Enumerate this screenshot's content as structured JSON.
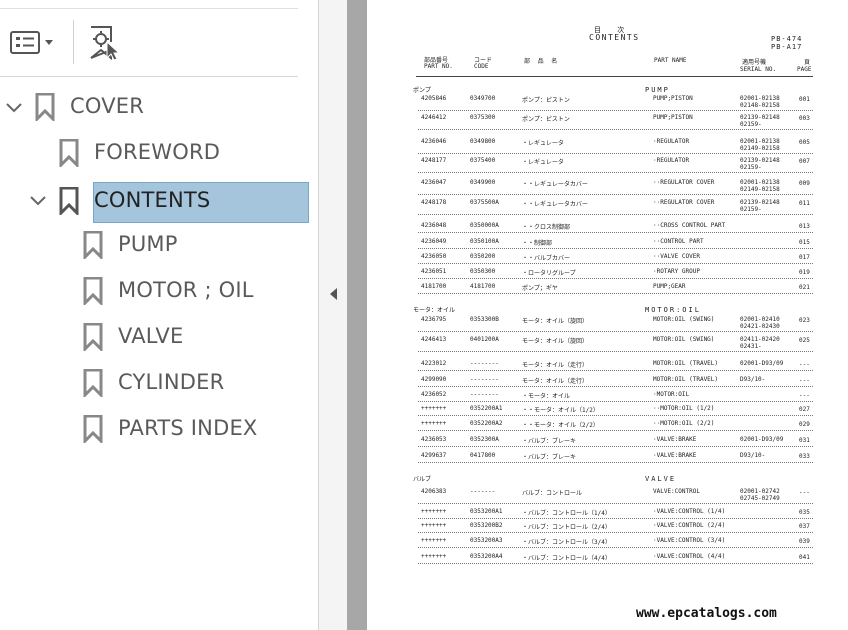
{
  "bookmarks": {
    "items": [
      {
        "label": "COVER",
        "level": 0,
        "expanded": true
      },
      {
        "label": "FOREWORD",
        "level": 1
      },
      {
        "label": "CONTENTS",
        "level": 1,
        "expanded": true,
        "selected": true
      },
      {
        "label": "PUMP",
        "level": 2
      },
      {
        "label": "MOTOR ; OIL",
        "level": 2
      },
      {
        "label": "VALVE",
        "level": 2
      },
      {
        "label": "CYLINDER",
        "level": 2
      },
      {
        "label": "PARTS INDEX",
        "level": 2
      }
    ]
  },
  "toolbar": {
    "options_icon": "list-options-icon",
    "find_bookmark_icon": "find-bookmark-icon"
  },
  "document": {
    "title_jp": "目 次",
    "title_en": "CONTENTS",
    "code1": "PB-474",
    "code2": "PB-A17",
    "headers": {
      "part_no_jp": "部品番号",
      "part_no": "PART NO.",
      "code_jp": "コード",
      "code": "CODE",
      "name_jp": "部 品 名",
      "part_name": "PART NAME",
      "serial_jp": "適用号機",
      "serial": "SERIAL NO.",
      "page_jp": "頁",
      "page": "PAGE"
    },
    "sections": [
      {
        "jp": "ポンプ",
        "en": "PUMP",
        "rows": [
          {
            "part": "4205846",
            "code": "0349700",
            "jp": "ポンプ：ピストン",
            "en": "PUMP;PISTON",
            "serial": [
              "02001-02138",
              "02148-02158"
            ],
            "page": "001"
          },
          {
            "part": "4246412",
            "code": "0375300",
            "jp": "ポンプ：ピストン",
            "en": "PUMP;PISTON",
            "serial": [
              "02139-02148",
              "02159-"
            ],
            "page": "003"
          },
          {
            "part": "4236046",
            "code": "0349800",
            "jp": "・レギュレータ",
            "en": "·REGULATOR",
            "serial": [
              "02001-02138",
              "02149-02158"
            ],
            "page": "005"
          },
          {
            "part": "4248177",
            "code": "0375400",
            "jp": "・レギュレータ",
            "en": "·REGULATOR",
            "serial": [
              "02139-02148",
              "02159-"
            ],
            "page": "007"
          },
          {
            "part": "4236047",
            "code": "0349900",
            "jp": "・・レギュレータカバー",
            "en": "··REGULATOR COVER",
            "serial": [
              "02001-02138",
              "02149-02158"
            ],
            "page": "009"
          },
          {
            "part": "4248178",
            "code": "0375500A",
            "jp": "・・レギュレータカバー",
            "en": "··REGULATOR COVER",
            "serial": [
              "02139-02148",
              "02159-"
            ],
            "page": "011"
          },
          {
            "part": "4236048",
            "code": "0350000A",
            "jp": "・・クロス制御部",
            "en": "··CROSS CONTROL PART",
            "serial": [],
            "page": "013"
          },
          {
            "part": "4236049",
            "code": "0350100A",
            "jp": "・・制御部",
            "en": "··CONTROL PART",
            "serial": [],
            "page": "015"
          },
          {
            "part": "4236050",
            "code": "0350200",
            "jp": "・・バルブカバー",
            "en": "··VALVE COVER",
            "serial": [],
            "page": "017"
          },
          {
            "part": "4236051",
            "code": "0350300",
            "jp": "・ロータリグループ",
            "en": "·ROTARY GROUP",
            "serial": [],
            "page": "019"
          },
          {
            "part": "4181700",
            "code": "4181700",
            "jp": "ポンプ；ギヤ",
            "en": "PUMP;GEAR",
            "serial": [],
            "page": "021"
          }
        ]
      },
      {
        "jp": "モータ：オイル",
        "en": "MOTOR:OIL",
        "rows": [
          {
            "part": "4236795",
            "code": "0353300B",
            "jp": "モータ：オイル（旋回）",
            "en": "MOTOR:OIL (SWING)",
            "serial": [
              "02001-02410",
              "02421-02430"
            ],
            "page": "023"
          },
          {
            "part": "4246413",
            "code": "0401200A",
            "jp": "モータ：オイル（旋回）",
            "en": "MOTOR:OIL (SWING)",
            "serial": [
              "02411-02420",
              "02431-"
            ],
            "page": "025"
          },
          {
            "part": "4223012",
            "code": "--------",
            "jp": "モータ：オイル（走行）",
            "en": "MOTOR:OIL (TRAVEL)",
            "serial": [
              "02001-D93/09"
            ],
            "page": "---"
          },
          {
            "part": "4299090",
            "code": "--------",
            "jp": "モータ：オイル（走行）",
            "en": "MOTOR:OIL (TRAVEL)",
            "serial": [
              "D93/10-"
            ],
            "page": "---"
          },
          {
            "part": "4236052",
            "code": "--------",
            "jp": "・モータ：オイル",
            "en": "·MOTOR:OIL",
            "serial": [],
            "page": "---"
          },
          {
            "part": "+++++++",
            "code": "0352200A1",
            "jp": "・・モータ：オイル（1/2）",
            "en": "··MOTOR:OIL (1/2)",
            "serial": [],
            "page": "027"
          },
          {
            "part": "+++++++",
            "code": "0352200A2",
            "jp": "・・モータ：オイル（2/2）",
            "en": "··MOTOR:OIL (2/2)",
            "serial": [],
            "page": "029"
          },
          {
            "part": "4236053",
            "code": "0352300A",
            "jp": "・バルブ：ブレーキ",
            "en": "·VALVE:BRAKE",
            "serial": [
              "02001-D93/09"
            ],
            "page": "031"
          },
          {
            "part": "4299637",
            "code": "0417800",
            "jp": "・バルブ：ブレーキ",
            "en": "·VALVE:BRAKE",
            "serial": [
              "D93/10-"
            ],
            "page": "033"
          }
        ]
      },
      {
        "jp": "バルブ",
        "en": "VALVE",
        "rows": [
          {
            "part": "4206383",
            "code": "-------",
            "jp": "バルブ：コントロール",
            "en": "VALVE:CONTROL",
            "serial": [
              "02001-02742",
              "02745-02749"
            ],
            "page": "---"
          },
          {
            "part": "+++++++",
            "code": "0353200A1",
            "jp": "・バルブ：コントロール（1/4）",
            "en": "·VALVE:CONTROL (1/4)",
            "serial": [],
            "page": "035"
          },
          {
            "part": "+++++++",
            "code": "0353200B2",
            "jp": "・バルブ：コントロール（2/4）",
            "en": "·VALVE:CONTROL (2/4)",
            "serial": [],
            "page": "037"
          },
          {
            "part": "+++++++",
            "code": "0353200A3",
            "jp": "・バルブ：コントロール（3/4）",
            "en": "·VALVE:CONTROL (3/4)",
            "serial": [],
            "page": "039"
          },
          {
            "part": "+++++++",
            "code": "0353200A4",
            "jp": "・バルブ：コントロール（4/4）",
            "en": "·VALVE:CONTROL (4/4)",
            "serial": [],
            "page": "041"
          }
        ]
      }
    ]
  },
  "watermark": "www.epcatalogs.com"
}
